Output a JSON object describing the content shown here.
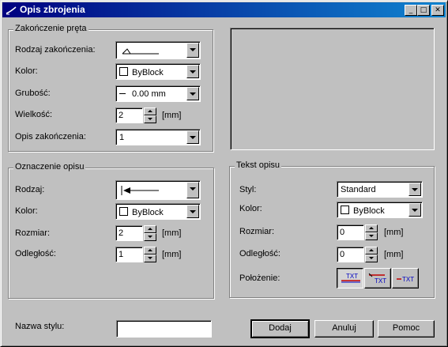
{
  "window": {
    "title": "Opis zbrojenia",
    "buttons": [
      "_",
      "□",
      "✕"
    ]
  },
  "zakonczenie": {
    "title": "Zakończenie pręta",
    "rodzaj_label": "Rodzaj zakończenia:",
    "kolor_label": "Kolor:",
    "kolor_value": "ByBlock",
    "grubosc_label": "Grubość:",
    "grubosc_value": "0.00 mm",
    "wielkosc_label": "Wielkość:",
    "wielkosc_value": "2",
    "wielkosc_unit": "[mm]",
    "opis_label": "Opis zakończenia:",
    "opis_value": "1"
  },
  "oznaczenie": {
    "title": "Oznaczenie opisu",
    "rodzaj_label": "Rodzaj:",
    "kolor_label": "Kolor:",
    "kolor_value": "ByBlock",
    "rozmiar_label": "Rozmiar:",
    "rozmiar_value": "2",
    "rozmiar_unit": "[mm]",
    "odleglosc_label": "Odległość:",
    "odleglosc_value": "1",
    "odleglosc_unit": "[mm]"
  },
  "tekst": {
    "title": "Tekst opisu",
    "styl_label": "Styl:",
    "styl_value": "Standard",
    "kolor_label": "Kolor:",
    "kolor_value": "ByBlock",
    "rozmiar_label": "Rozmiar:",
    "rozmiar_value": "0",
    "rozmiar_unit": "[mm]",
    "odleglosc_label": "Odległość:",
    "odleglosc_value": "0",
    "odleglosc_unit": "[mm]",
    "polozenie_label": "Położenie:",
    "position_icons": [
      "TXT",
      "TXT",
      "TXT"
    ]
  },
  "footer": {
    "nazwa_label": "Nazwa stylu:",
    "nazwa_value": "",
    "dodaj": "Dodaj",
    "anuluj": "Anuluj",
    "pomoc": "Pomoc"
  },
  "colors": {
    "titlebar": "#000080",
    "face": "#c0c0c0",
    "accent_red": "#c00000",
    "accent_blue": "#0000c0"
  }
}
